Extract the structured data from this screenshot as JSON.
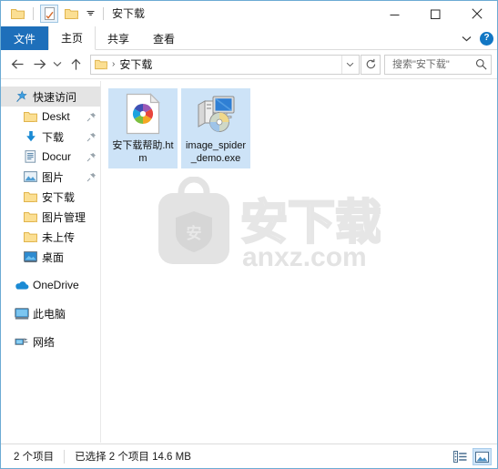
{
  "window": {
    "title": "安下载",
    "accent_color": "#1e6fba",
    "border_color": "#6cabd4",
    "selection_color": "#cde3f7"
  },
  "quick_access_toolbar": {
    "items": [
      {
        "name": "folder-icon",
        "label": ""
      },
      {
        "name": "properties-icon",
        "label": ""
      },
      {
        "name": "new-folder-icon",
        "label": ""
      },
      {
        "name": "chevron-down-icon",
        "label": "▾"
      }
    ]
  },
  "window_controls": {
    "minimize": "—",
    "maximize": "▢",
    "close": "✕"
  },
  "ribbon": {
    "tabs": [
      {
        "label": "文件",
        "active": false,
        "is_file_menu": true
      },
      {
        "label": "主页",
        "active": true,
        "is_file_menu": false
      },
      {
        "label": "共享",
        "active": false,
        "is_file_menu": false
      },
      {
        "label": "查看",
        "active": false,
        "is_file_menu": false
      }
    ],
    "expand_label": "⌄",
    "help_label": "?"
  },
  "navigation": {
    "back": "←",
    "forward": "→",
    "recent": "⌄",
    "up": "↑",
    "address": {
      "crumbs": [
        "安下载"
      ],
      "separator": "›",
      "dropdown": "⌄",
      "refresh": "↻"
    },
    "search": {
      "placeholder": "搜索\"安下载\"",
      "value": "",
      "icon": "search-icon"
    }
  },
  "sidebar": {
    "items": [
      {
        "label": "快速访问",
        "icon": "star-pin-icon",
        "selected": true,
        "indent": false,
        "pinned": false
      },
      {
        "label": "Deskt",
        "icon": "folder-icon",
        "selected": false,
        "indent": true,
        "pinned": true
      },
      {
        "label": "下载",
        "icon": "download-arrow-icon",
        "selected": false,
        "indent": true,
        "pinned": true
      },
      {
        "label": "Docur",
        "icon": "document-icon",
        "selected": false,
        "indent": true,
        "pinned": true
      },
      {
        "label": "图片",
        "icon": "pictures-icon",
        "selected": false,
        "indent": true,
        "pinned": true
      },
      {
        "label": "安下载",
        "icon": "folder-icon",
        "selected": false,
        "indent": true,
        "pinned": false
      },
      {
        "label": "图片管理",
        "icon": "folder-icon",
        "selected": false,
        "indent": true,
        "pinned": false
      },
      {
        "label": "未上传",
        "icon": "folder-icon",
        "selected": false,
        "indent": true,
        "pinned": false
      },
      {
        "label": "桌面",
        "icon": "desktop-icon",
        "selected": false,
        "indent": true,
        "pinned": false
      },
      {
        "label": "OneDrive",
        "icon": "onedrive-cloud-icon",
        "selected": false,
        "indent": false,
        "pinned": false,
        "gap_before": true
      },
      {
        "label": "此电脑",
        "icon": "this-pc-icon",
        "selected": false,
        "indent": false,
        "pinned": false,
        "gap_before": true
      },
      {
        "label": "网络",
        "icon": "network-icon",
        "selected": false,
        "indent": false,
        "pinned": false,
        "gap_before": true
      }
    ]
  },
  "files": [
    {
      "name": "安下载帮助.htm",
      "icon": "html-document-icon",
      "selected": true
    },
    {
      "name": "image_spider_demo.exe",
      "icon": "application-exe-icon",
      "selected": true
    }
  ],
  "watermark": {
    "text_cn": "安下载",
    "text_en": "anxz.com",
    "badge_char": "安"
  },
  "status": {
    "item_count": "2 个项目",
    "selection": "已选择 2 个项目  14.6 MB",
    "views": [
      {
        "name": "details-view-button",
        "active": false
      },
      {
        "name": "large-icons-view-button",
        "active": true
      }
    ]
  }
}
